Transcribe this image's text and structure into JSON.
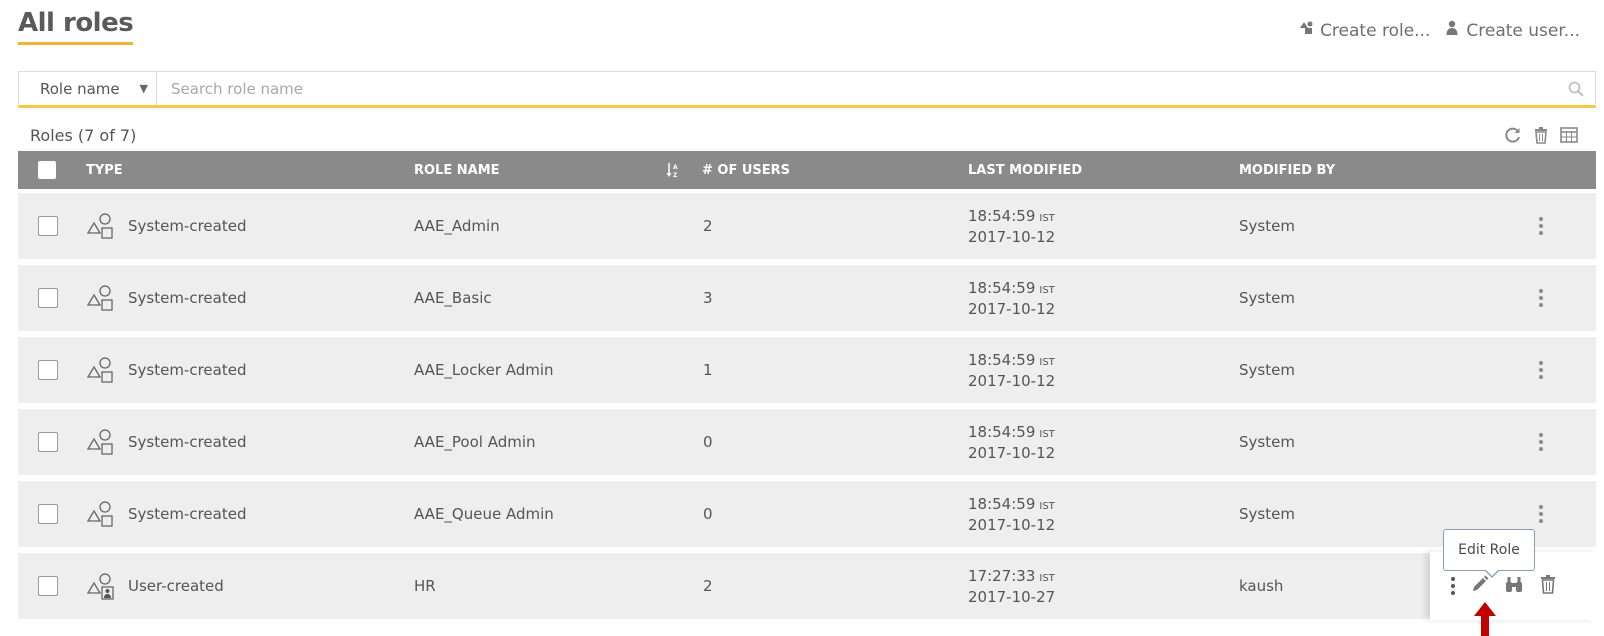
{
  "page": {
    "title": "All roles",
    "create_role_label": "Create role...",
    "create_user_label": "Create user..."
  },
  "search": {
    "field_selected": "Role name",
    "placeholder": "Search role name"
  },
  "table": {
    "count_label": "Roles (7 of 7)",
    "columns": [
      "TYPE",
      "ROLE NAME",
      "# OF USERS",
      "LAST MODIFIED",
      "MODIFIED BY"
    ],
    "rows": [
      {
        "type": "System-created",
        "name": "AAE_Admin",
        "users": "2",
        "time": "18:54:59",
        "tz": "IST",
        "date": "2017-10-12",
        "modified_by": "System"
      },
      {
        "type": "System-created",
        "name": "AAE_Basic",
        "users": "3",
        "time": "18:54:59",
        "tz": "IST",
        "date": "2017-10-12",
        "modified_by": "System"
      },
      {
        "type": "System-created",
        "name": "AAE_Locker Admin",
        "users": "1",
        "time": "18:54:59",
        "tz": "IST",
        "date": "2017-10-12",
        "modified_by": "System"
      },
      {
        "type": "System-created",
        "name": "AAE_Pool Admin",
        "users": "0",
        "time": "18:54:59",
        "tz": "IST",
        "date": "2017-10-12",
        "modified_by": "System"
      },
      {
        "type": "System-created",
        "name": "AAE_Queue Admin",
        "users": "0",
        "time": "18:54:59",
        "tz": "IST",
        "date": "2017-10-12",
        "modified_by": "System"
      },
      {
        "type": "User-created",
        "name": "HR",
        "users": "2",
        "time": "17:27:33",
        "tz": "IST",
        "date": "2017-10-27",
        "modified_by": "kaush"
      }
    ]
  },
  "tooltip": {
    "label": "Edit Role"
  },
  "colors": {
    "accent": "#f1b52f",
    "header_bg": "#8a8a8a",
    "row_bg": "#eeeeee",
    "arrow": "#c00000"
  },
  "icons": {
    "create_role": "roles-icon",
    "create_user": "user-icon",
    "search": "search-icon",
    "refresh": "refresh-icon",
    "delete": "trash-icon",
    "columns": "columns-icon",
    "sort": "sort-az-icon",
    "system_type": "shapes-icon",
    "user_type": "shapes-user-icon",
    "edit": "pencil-icon",
    "view": "binoculars-icon"
  }
}
